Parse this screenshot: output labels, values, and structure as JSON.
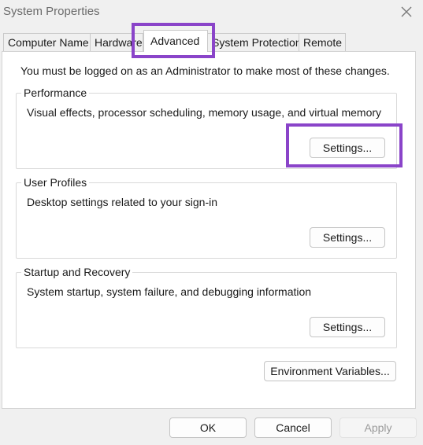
{
  "window": {
    "title": "System Properties"
  },
  "tabs": [
    {
      "label": "Computer Name"
    },
    {
      "label": "Hardware"
    },
    {
      "label": "Advanced"
    },
    {
      "label": "System Protection"
    },
    {
      "label": "Remote"
    }
  ],
  "notice": "You must be logged on as an Administrator to make most of these changes.",
  "performance": {
    "title": "Performance",
    "description": "Visual effects, processor scheduling, memory usage, and virtual memory",
    "button": "Settings..."
  },
  "user_profiles": {
    "title": "User Profiles",
    "description": "Desktop settings related to your sign-in",
    "button": "Settings..."
  },
  "startup_recovery": {
    "title": "Startup and Recovery",
    "description": "System startup, system failure, and debugging information",
    "button": "Settings..."
  },
  "env_button": "Environment Variables...",
  "footer": {
    "ok": "OK",
    "cancel": "Cancel",
    "apply": "Apply"
  },
  "highlight_color": "#8a44c9",
  "icons": {
    "close": "close-icon"
  }
}
